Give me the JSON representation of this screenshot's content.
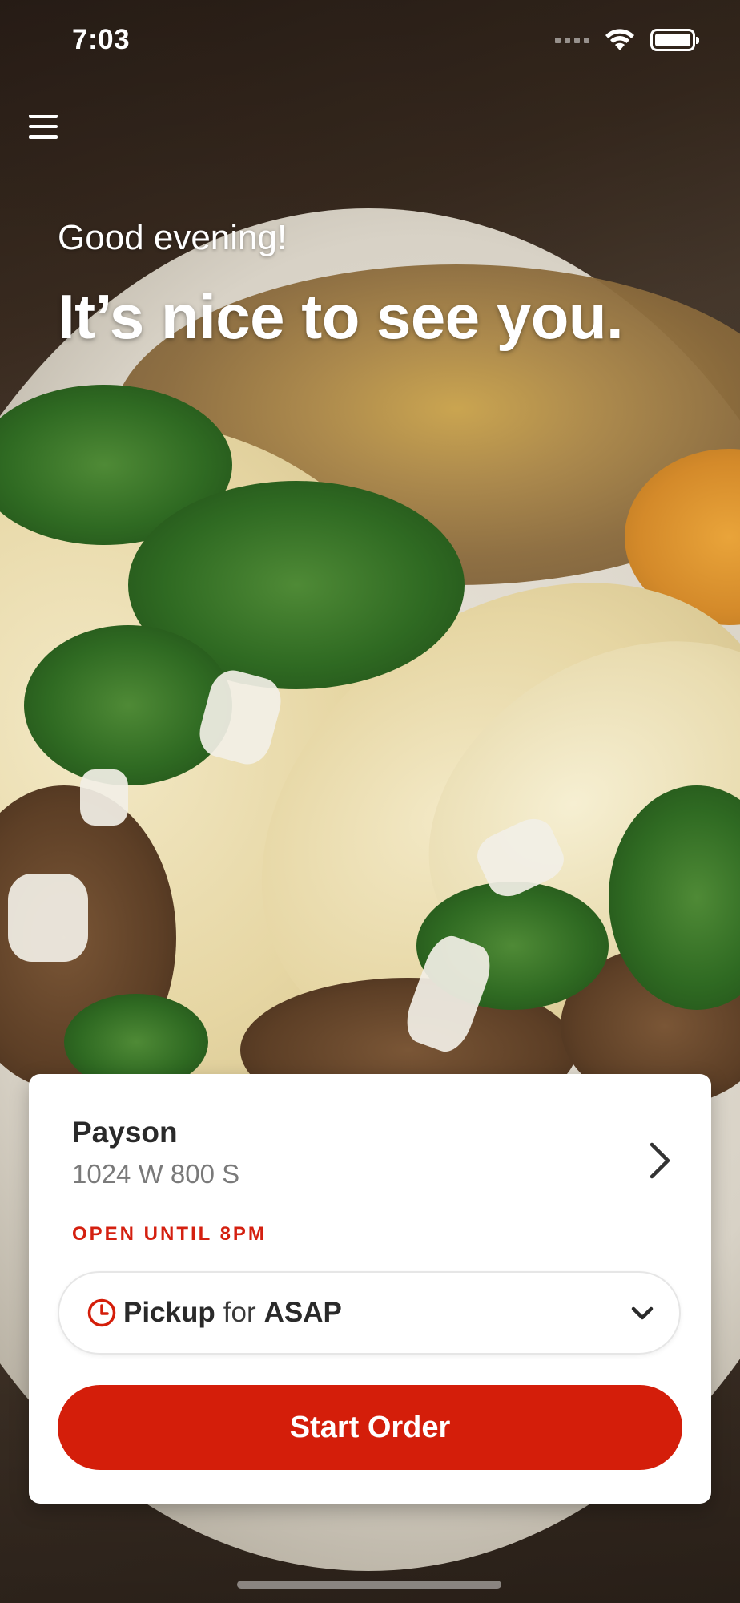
{
  "status_bar": {
    "time": "7:03",
    "icons": [
      "signal-icon",
      "wifi-icon",
      "battery-icon"
    ]
  },
  "menu": {
    "icon": "hamburger-menu-icon"
  },
  "greeting": {
    "salutation": "Good evening!",
    "headline": "It’s nice to see you."
  },
  "location": {
    "name": "Payson",
    "address": "1024 W 800 S",
    "hours_status": "OPEN UNTIL 8PM"
  },
  "order_mode": {
    "icon": "clock-icon",
    "mode": "Pickup",
    "connector": "for",
    "time": "ASAP"
  },
  "actions": {
    "start_order_label": "Start Order"
  },
  "colors": {
    "accent": "#d41e0a",
    "card_background": "#ffffff",
    "text_primary": "#2a2a2a",
    "text_secondary": "#7a7a7a"
  }
}
